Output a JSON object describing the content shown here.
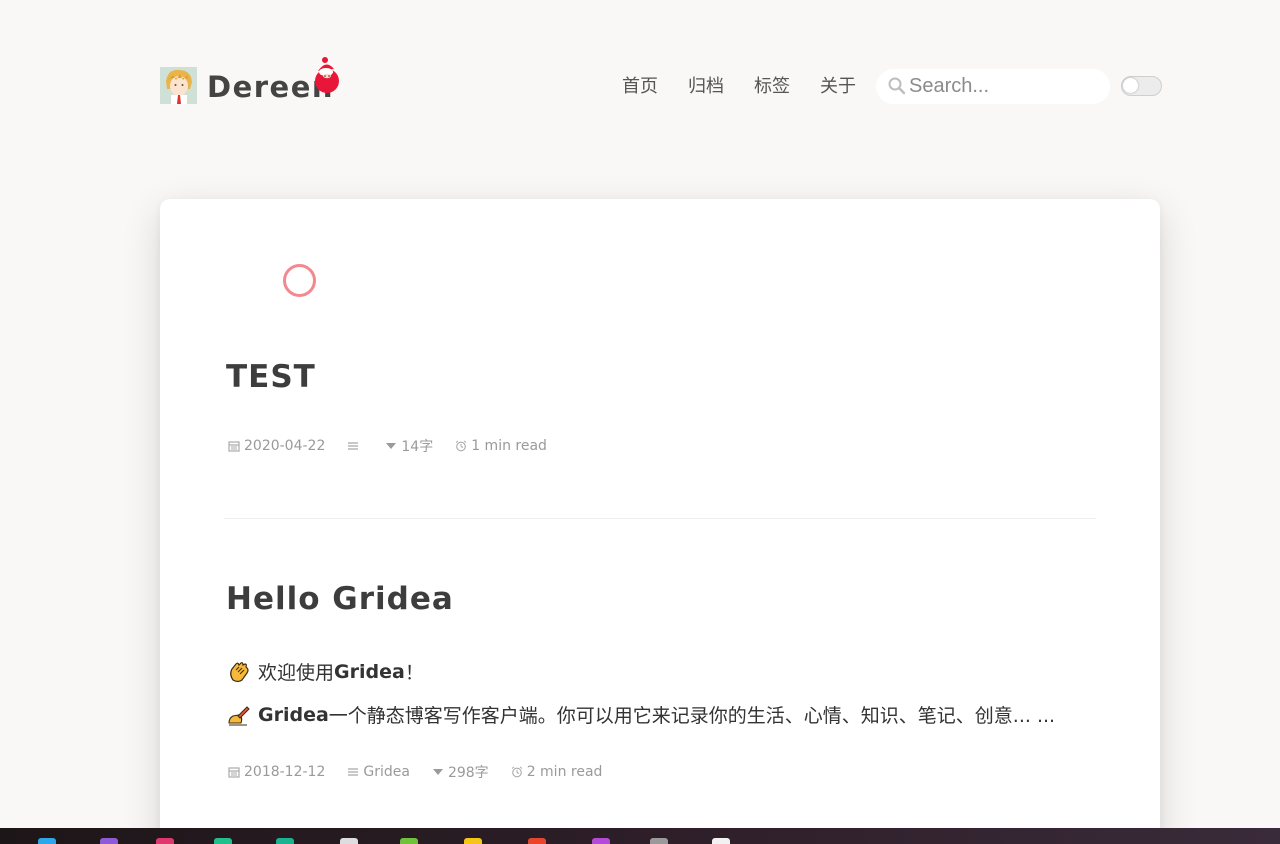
{
  "header": {
    "site_name": "Dereen",
    "nav": [
      "首页",
      "归档",
      "标签",
      "关于"
    ],
    "search_placeholder": "Search..."
  },
  "posts": [
    {
      "title": "TEST",
      "date": "2020-04-22",
      "tag": "",
      "words": "14字",
      "read_time": "1 min read"
    },
    {
      "title": "Hello Gridea",
      "excerpt_1_pre": "欢迎使用 ",
      "excerpt_1_bold": "Gridea",
      "excerpt_1_post": "！",
      "excerpt_2_bold": "Gridea",
      "excerpt_2_text": " 一个静态博客写作客户端。你可以用它来记录你的生活、心情、知识、笔记、创意... ...",
      "date": "2018-12-12",
      "tag": "Gridea",
      "words": "298字",
      "read_time": "2 min read"
    }
  ],
  "icons": {
    "search": "search-icon",
    "theme_toggle": "theme-toggle",
    "calendar": "calendar-icon",
    "tag": "list-icon",
    "words": "caret-down-icon",
    "read_time": "alarm-clock-icon",
    "clap": "clapping-hands-icon",
    "writing": "writing-hand-icon"
  },
  "colors": {
    "background": "#f9f8f6",
    "card": "#ffffff",
    "accent": "#e8173a",
    "loader": "#f3898f",
    "meta_text": "#9a9a9a"
  }
}
